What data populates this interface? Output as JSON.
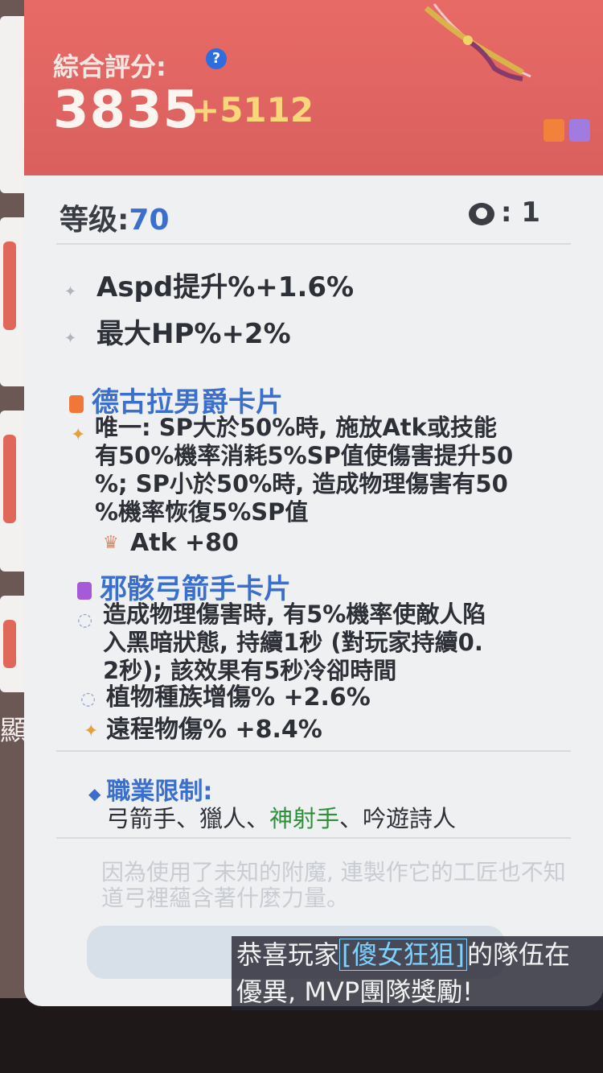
{
  "tooltip": {
    "score_label": "綜合評分:",
    "score_value": "3835",
    "score_bonus": "+5112",
    "level_label": "等级:",
    "level_value": "70",
    "refine_value": ": 1",
    "stats": [
      "Aspd提升%+1.6%",
      "最大HP%+2%"
    ],
    "cards": [
      {
        "title": "德古拉男爵卡片",
        "color": "#f0773a",
        "lines": [
          "唯一: SP大於50%時, 施放Atk或技能",
          "有50%機率消耗5%SP值使傷害提升50",
          "%; SP小於50%時, 造成物理傷害有50",
          "%機率恢復5%SP值"
        ],
        "bonus": "Atk +80"
      },
      {
        "title": "邪骸弓箭手卡片",
        "color": "#a65ad8",
        "lines": [
          "造成物理傷害時, 有5%機率使敵人陷",
          "入黑暗狀態, 持續1秒 (對玩家持續0.",
          "2秒); 該效果有5秒冷卻時間"
        ],
        "bonus1": "植物種族增傷% +2.6%",
        "bonus2": "遠程物傷% +8.4%"
      }
    ],
    "job_label": "職業限制:",
    "jobs": {
      "j1": "弓箭手、",
      "j2": "獵人、",
      "j3": "神射手",
      "j4": "、吟遊詩人"
    },
    "flavor": "因為使用了未知的附魔, 連製作它的工匠也不知道弓裡蘊含著什麼力量。"
  },
  "background": {
    "side_text": "顯示"
  },
  "broadcast": {
    "prefix": "恭喜玩家",
    "player": "[傻女狂狙]",
    "suffix": "的隊伍在",
    "line2": "優異, MVP團隊獎勵!"
  },
  "colors": {
    "header": "#e86a66",
    "accent_blue": "#3a6fcd",
    "bonus_yellow": "#f7d77a"
  }
}
